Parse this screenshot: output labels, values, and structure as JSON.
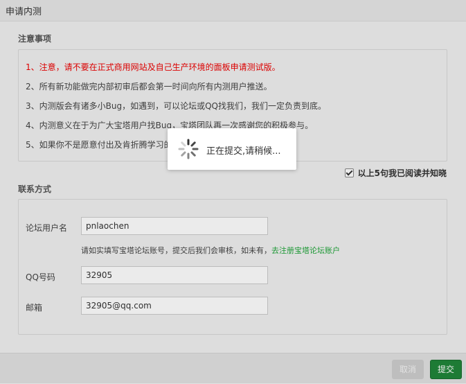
{
  "dialog": {
    "title": "申请内测"
  },
  "notice": {
    "section_title": "注意事项",
    "items": [
      "1、注意，请不要在正式商用网站及自己生产环境的面板申请测试版。",
      "2、所有新功能做完内部初审后都会第一时间向所有内测用户推送。",
      "3、内测版会有诸多小Bug，如遇到，可以论坛或QQ找我们，我们一定负责到底。",
      "4、内测意义在于为广大宝塔用户找Bug，宝塔团队再一次感谢您的积极参与。",
      "5、如果你不是愿意付出及肯折腾学习的"
    ],
    "warn_color": "#e00000"
  },
  "agree": {
    "label": "以上5句我已阅读并知晓",
    "checked": true
  },
  "contact": {
    "section_title": "联系方式",
    "username_label": "论坛用户名",
    "username_value": "pnlaochen",
    "hint_text": "请如实填写宝塔论坛账号，提交后我们会审核，如未有，",
    "hint_link": "去注册宝塔论坛账户",
    "qq_label": "QQ号码",
    "qq_value": "32905",
    "email_label": "邮箱",
    "email_value": "32905@qq.com"
  },
  "footer": {
    "cancel_label": "取消",
    "submit_label": "提交",
    "submit_color": "#20863a"
  },
  "loading": {
    "message": "正在提交,请稍候..."
  }
}
